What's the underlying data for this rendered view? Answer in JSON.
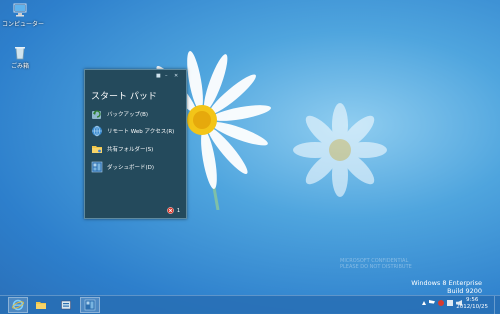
{
  "desktop": {
    "icons": [
      {
        "label": "コンピューター",
        "icon": "computer-icon"
      },
      {
        "label": "ごみ箱",
        "icon": "recycle-bin-icon"
      }
    ]
  },
  "widget": {
    "title": "スタート パッド",
    "items": [
      {
        "label": "バックアップ(B)",
        "icon": "backup-icon"
      },
      {
        "label": "リモート Web アクセス(R)",
        "icon": "remote-web-access-icon"
      },
      {
        "label": "共有フォルダー(S)",
        "icon": "shared-folder-icon"
      },
      {
        "label": "ダッシュボード(D)",
        "icon": "dashboard-icon"
      }
    ],
    "alert_count": "1"
  },
  "watermark": {
    "line1": "MICROSOFT CONFIDENTIAL",
    "line2": "PLEASE DO NOT DISTRIBUTE"
  },
  "build_info": {
    "edition": "Windows 8 Enterprise",
    "build": "Build 9200"
  },
  "taskbar": {
    "apps": [
      "internet-explorer-icon",
      "file-explorer-icon",
      "server-manager-icon",
      "dashboard-icon"
    ],
    "time": "9:56",
    "date": "2012/10/25"
  },
  "colors": {
    "widget_bg": "#244a5c",
    "taskbar_bg": "#286eb4",
    "wallpaper": "#4fa5de"
  }
}
